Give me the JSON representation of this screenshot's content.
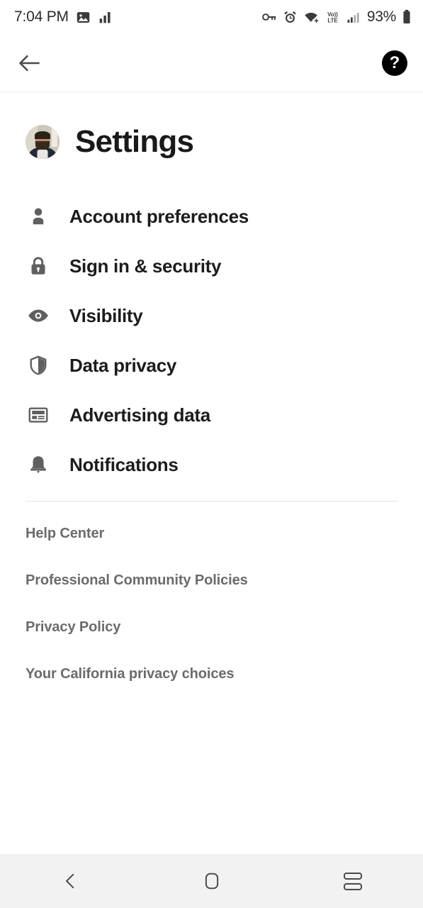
{
  "status_bar": {
    "time": "7:04 PM",
    "battery_percent": "93%",
    "left_icons": [
      "photo-icon",
      "signal-bars-icon"
    ],
    "right_icons": [
      "vpn-key-icon",
      "alarm-clock-icon",
      "wifi-icon",
      "volte-icon",
      "cellular-signal-icon",
      "battery-icon"
    ],
    "volte_label_top": "Vo))",
    "volte_label_bottom": "LTE"
  },
  "app_bar": {
    "back_icon": "back-arrow-icon",
    "help_icon": "help-question-icon",
    "help_glyph": "?"
  },
  "header": {
    "title": "Settings",
    "avatar": "profile-avatar"
  },
  "menu": {
    "items": [
      {
        "label": "Account preferences",
        "icon": "person-icon"
      },
      {
        "label": "Sign in & security",
        "icon": "lock-icon"
      },
      {
        "label": "Visibility",
        "icon": "eye-icon"
      },
      {
        "label": "Data privacy",
        "icon": "shield-icon"
      },
      {
        "label": "Advertising data",
        "icon": "ad-card-icon"
      },
      {
        "label": "Notifications",
        "icon": "bell-icon"
      }
    ]
  },
  "footer_links": [
    {
      "label": "Help Center"
    },
    {
      "label": "Professional Community Policies"
    },
    {
      "label": "Privacy Policy"
    },
    {
      "label": "Your California privacy choices"
    }
  ],
  "nav_bar": {
    "back": "nav-back-icon",
    "home": "nav-home-icon",
    "recents": "nav-recents-icon"
  },
  "colors": {
    "background": "#ffffff",
    "text_primary": "#1c1c1c",
    "text_secondary": "#6b6b6b",
    "icon_gray": "#5f5f5f",
    "nav_bar_bg": "#f2f2f2",
    "help_badge": "#000000"
  }
}
